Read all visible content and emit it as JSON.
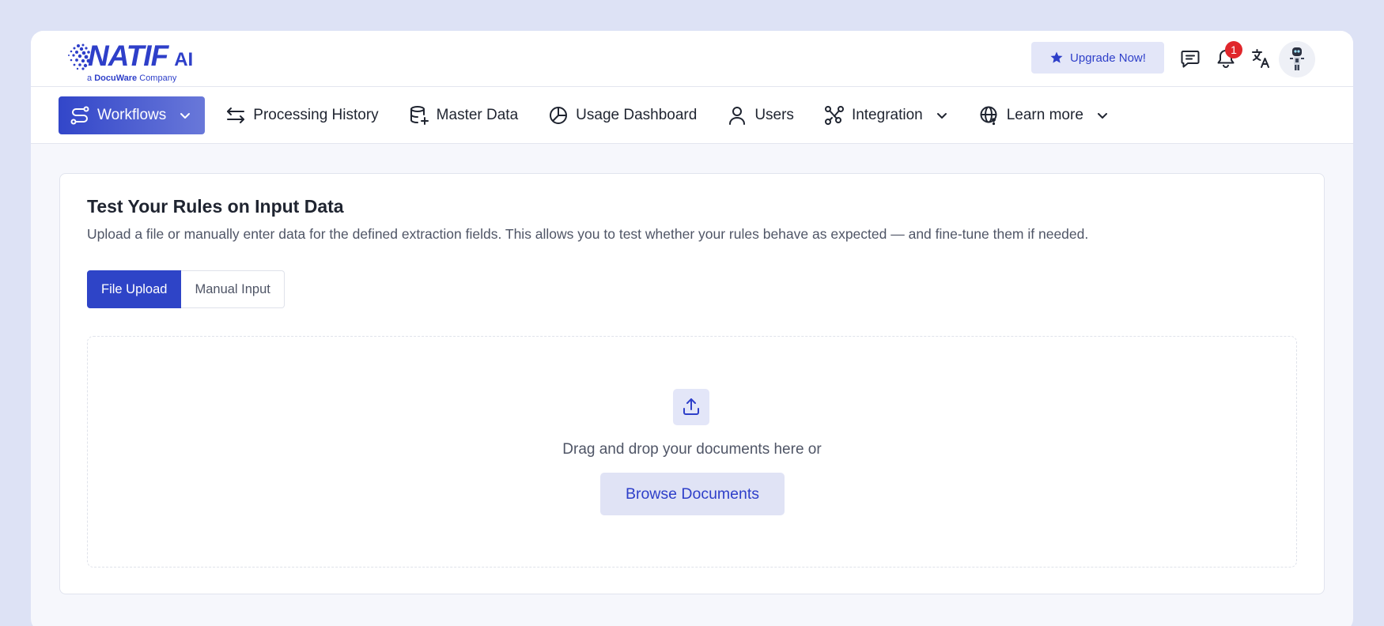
{
  "header": {
    "logo_text": "NATIF",
    "logo_suffix": "AI",
    "logo_tagline_prefix": "a ",
    "logo_tagline_brand": "DocuWare",
    "logo_tagline_suffix": " Company",
    "upgrade_label": "Upgrade Now!",
    "notification_count": "1",
    "icons": [
      "chat-icon",
      "bell-icon",
      "translate-icon",
      "avatar"
    ]
  },
  "nav": {
    "items": [
      {
        "label": "Workflows",
        "icon": "workflow-icon",
        "has_dropdown": true,
        "active": true
      },
      {
        "label": "Processing History",
        "icon": "arrows-exchange-icon"
      },
      {
        "label": "Master Data",
        "icon": "database-plus-icon"
      },
      {
        "label": "Usage Dashboard",
        "icon": "pie-chart-icon"
      },
      {
        "label": "Users",
        "icon": "user-icon"
      },
      {
        "label": "Integration",
        "icon": "integration-icon",
        "has_dropdown": true
      },
      {
        "label": "Learn more",
        "icon": "globe-help-icon",
        "has_dropdown": true
      }
    ]
  },
  "main": {
    "title": "Test Your Rules on Input Data",
    "description": "Upload a file or manually enter data for the defined extraction fields. This allows you to test whether your rules behave as expected — and fine-tune them if needed.",
    "tabs": [
      {
        "label": "File Upload",
        "selected": true
      },
      {
        "label": "Manual Input",
        "selected": false
      }
    ],
    "dropzone": {
      "text": "Drag and drop your documents here or",
      "browse_label": "Browse Documents"
    }
  },
  "colors": {
    "accent": "#2e44c7",
    "page_bg": "#dde2f5",
    "badge": "#e0262b"
  }
}
